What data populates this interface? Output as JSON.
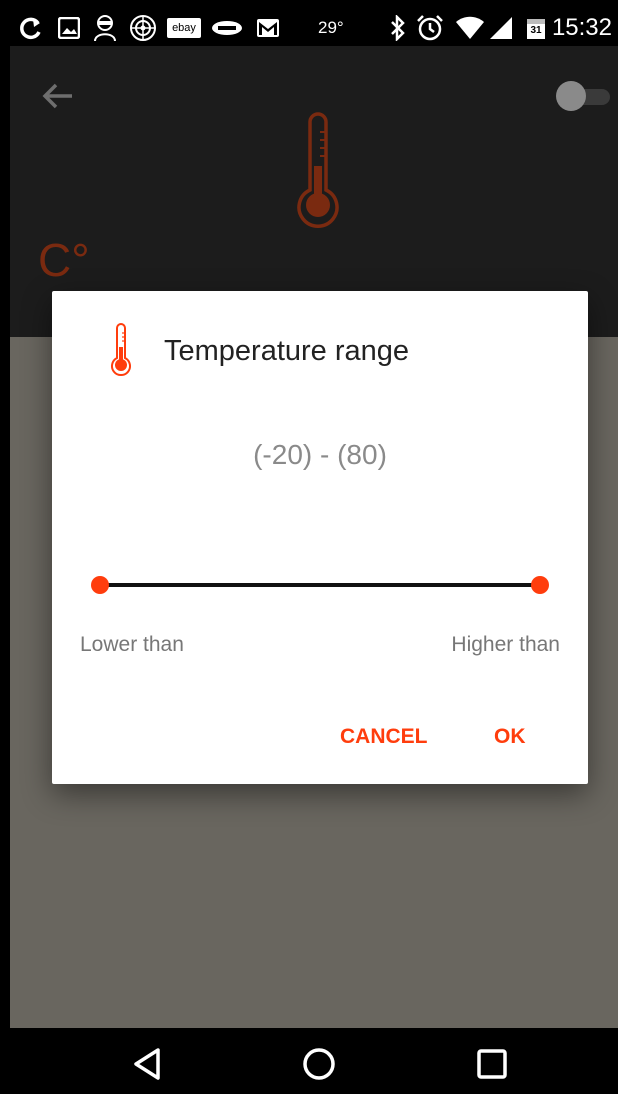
{
  "status_bar": {
    "temperature": "29°",
    "time": "15:32",
    "ebay_label": "ebay",
    "icons": [
      "sync-icon",
      "image-icon",
      "spy-icon",
      "radar-icon",
      "ebay-icon",
      "aliexpress-icon",
      "gmail-icon",
      "bluetooth-icon",
      "alarm-icon",
      "wifi-icon",
      "signal-icon",
      "calendar-icon"
    ],
    "calendar_day": "31"
  },
  "header": {
    "unit": "C°"
  },
  "dialog": {
    "title": "Temperature range",
    "range_value": "(-20) - (80)",
    "slider": {
      "min": -20,
      "max": 80,
      "low": -20,
      "high": 80
    },
    "lower_label": "Lower than",
    "higher_label": "Higher than",
    "cancel_label": "CANCEL",
    "ok_label": "OK"
  },
  "colors": {
    "accent": "#ff3d0d",
    "header_bg": "#1c1c1c",
    "scrim": "#69665f",
    "unit_color": "#7a2a10"
  }
}
